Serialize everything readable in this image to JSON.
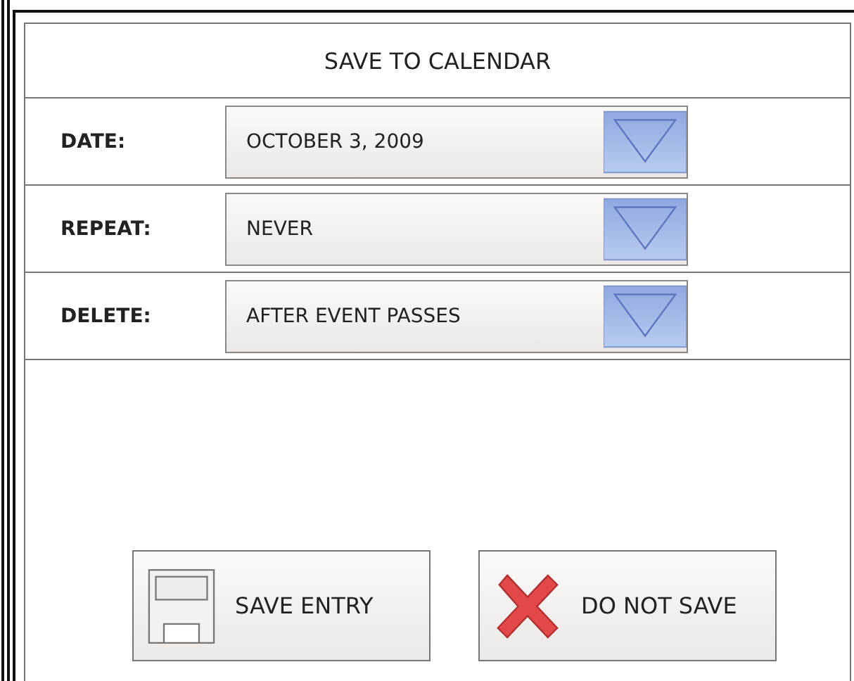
{
  "dialog": {
    "title": "SAVE TO CALENDAR"
  },
  "fields": [
    {
      "label": "DATE:",
      "value": "OCTOBER 3, 2009"
    },
    {
      "label": "REPEAT:",
      "value": "NEVER"
    },
    {
      "label": "DELETE:",
      "value": "AFTER EVENT PASSES"
    }
  ],
  "buttons": [
    {
      "kind": "save",
      "label": "SAVE ENTRY"
    },
    {
      "kind": "cancel",
      "label": "DO NOT SAVE"
    }
  ]
}
